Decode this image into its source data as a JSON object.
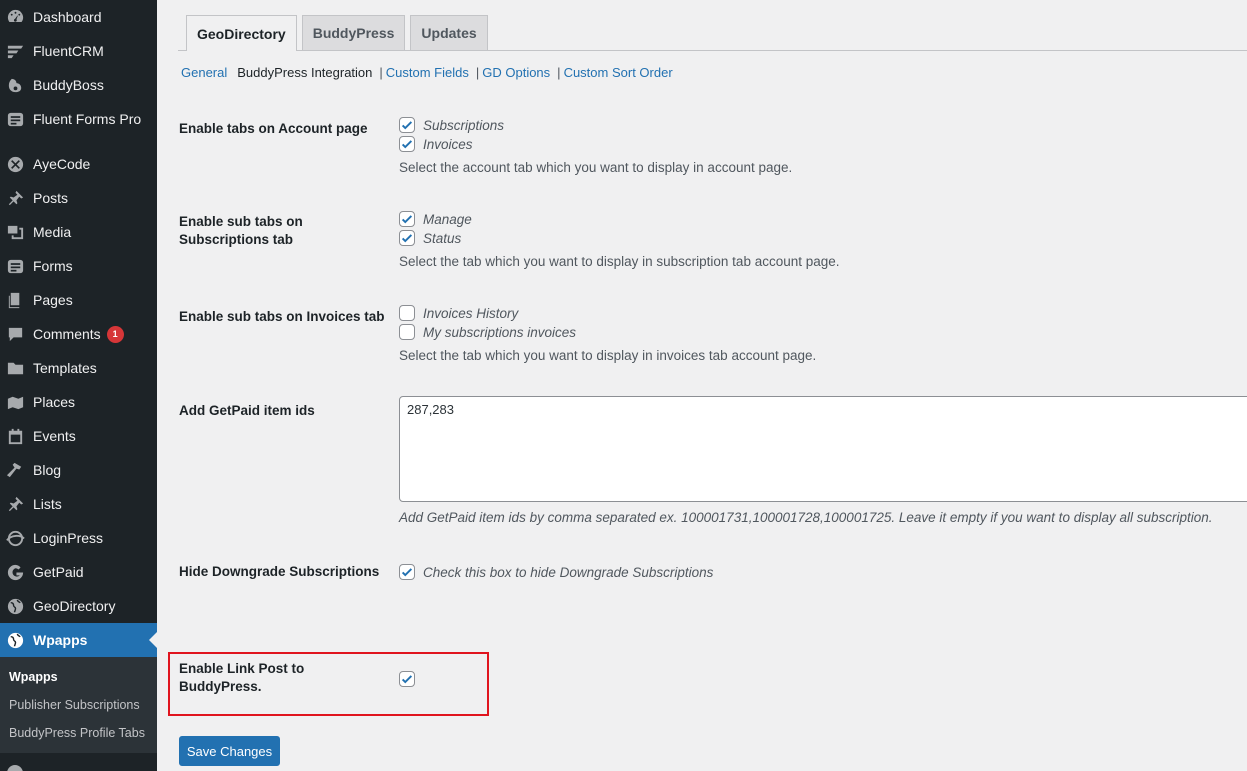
{
  "sidebar": {
    "items": [
      {
        "label": "Dashboard",
        "icon": "dashboard-icon"
      },
      {
        "label": "FluentCRM",
        "icon": "fluentcrm-icon"
      },
      {
        "label": "BuddyBoss",
        "icon": "buddyboss-icon"
      },
      {
        "label": "Fluent Forms Pro",
        "icon": "forms-icon"
      },
      {
        "label": "AyeCode",
        "icon": "ayecode-icon"
      },
      {
        "label": "Posts",
        "icon": "pin-icon"
      },
      {
        "label": "Media",
        "icon": "media-icon"
      },
      {
        "label": "Forms",
        "icon": "forms-icon"
      },
      {
        "label": "Pages",
        "icon": "pages-icon"
      },
      {
        "label": "Comments",
        "icon": "comments-icon",
        "badge": "1"
      },
      {
        "label": "Templates",
        "icon": "folder-icon"
      },
      {
        "label": "Places",
        "icon": "places-icon"
      },
      {
        "label": "Events",
        "icon": "calendar-icon"
      },
      {
        "label": "Blog",
        "icon": "hammer-icon"
      },
      {
        "label": "Lists",
        "icon": "pin-icon"
      },
      {
        "label": "LoginPress",
        "icon": "loginpress-icon"
      },
      {
        "label": "GetPaid",
        "icon": "getpaid-icon"
      },
      {
        "label": "GeoDirectory",
        "icon": "globe-icon"
      },
      {
        "label": "Wpapps",
        "icon": "globe-icon",
        "active": true
      }
    ],
    "submenu": [
      "Wpapps",
      "Publisher Subscriptions",
      "BuddyPress Profile Tabs"
    ]
  },
  "tabs": [
    "GeoDirectory",
    "BuddyPress",
    "Updates"
  ],
  "subnav": [
    "General",
    "BuddyPress Integration",
    "Custom Fields",
    "GD Options",
    "Custom Sort Order"
  ],
  "settings": {
    "account_tabs": {
      "label": "Enable tabs on Account page",
      "options": [
        {
          "label": "Subscriptions",
          "checked": true
        },
        {
          "label": "Invoices",
          "checked": true
        }
      ],
      "desc": "Select the account tab which you want to display in account page."
    },
    "subscription_tabs": {
      "label_line1": "Enable sub tabs on",
      "label_line2": "Subscriptions tab",
      "options": [
        {
          "label": "Manage",
          "checked": true
        },
        {
          "label": "Status",
          "checked": true
        }
      ],
      "desc": "Select the tab which you want to display in subscription tab account page."
    },
    "invoice_tabs": {
      "label": "Enable sub tabs on Invoices tab",
      "options": [
        {
          "label": "Invoices History",
          "checked": false
        },
        {
          "label": "My subscriptions invoices",
          "checked": false
        }
      ],
      "desc": "Select the tab which you want to display in invoices tab account page."
    },
    "item_ids": {
      "label": "Add GetPaid item ids",
      "value": "287,283",
      "desc": "Add GetPaid item ids by comma separated ex. 100001731,100001728,100001725. Leave it empty if you want to display all subscription."
    },
    "hide_downgrade": {
      "label": "Hide Downgrade Subscriptions",
      "option": "Check this box to hide Downgrade Subscriptions",
      "checked": true
    },
    "link_post": {
      "label_line1": "Enable Link Post to",
      "label_line2": "BuddyPress.",
      "checked": true
    }
  },
  "save_label": "Save Changes",
  "colors": {
    "accent": "#2271b1",
    "sidebar": "#1d2327",
    "highlight": "#e0141e"
  }
}
